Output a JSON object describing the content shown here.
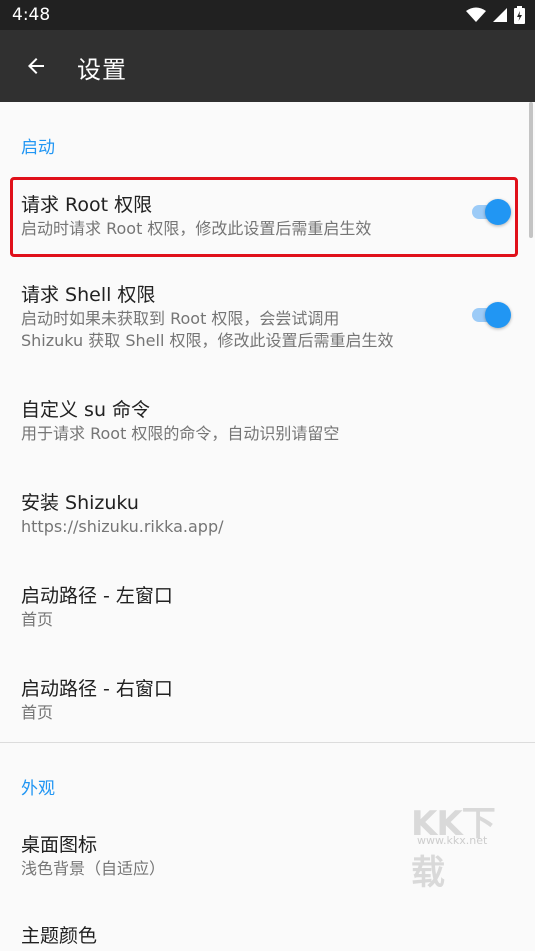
{
  "status_bar": {
    "time": "4:48",
    "icons": [
      "wifi-icon",
      "signal-icon",
      "battery-icon"
    ]
  },
  "app_bar": {
    "title": "设置",
    "back_icon": "arrow-left-icon"
  },
  "sections": [
    {
      "header": "启动",
      "items": [
        {
          "title": "请求 Root 权限",
          "summary": "启动时请求 Root 权限，修改此设置后需重启生效",
          "switch_on": true
        },
        {
          "title": "请求 Shell 权限",
          "summary_lines": [
            "启动时如果未获取到 Root 权限，会尝试调用",
            "Shizuku 获取 Shell 权限，修改此设置后需重启生效"
          ],
          "switch_on": true
        },
        {
          "title": "自定义 su 命令",
          "summary": "用于请求 Root 权限的命令，自动识别请留空"
        },
        {
          "title": "安装 Shizuku",
          "summary": "https://shizuku.rikka.app/"
        },
        {
          "title": "启动路径 - 左窗口",
          "summary": "首页"
        },
        {
          "title": "启动路径 - 右窗口",
          "summary": "首页"
        }
      ]
    },
    {
      "header": "外观",
      "items": [
        {
          "title": "桌面图标",
          "summary": "浅色背景（自适应）"
        },
        {
          "title": "主题颜色"
        }
      ]
    }
  ],
  "colors": {
    "accent": "#2196f3",
    "highlight": "#e0101a",
    "app_bar": "#303030",
    "status_bar": "#212121"
  },
  "watermark": {
    "logo": "KK下载",
    "url": "www.kkx.net"
  }
}
